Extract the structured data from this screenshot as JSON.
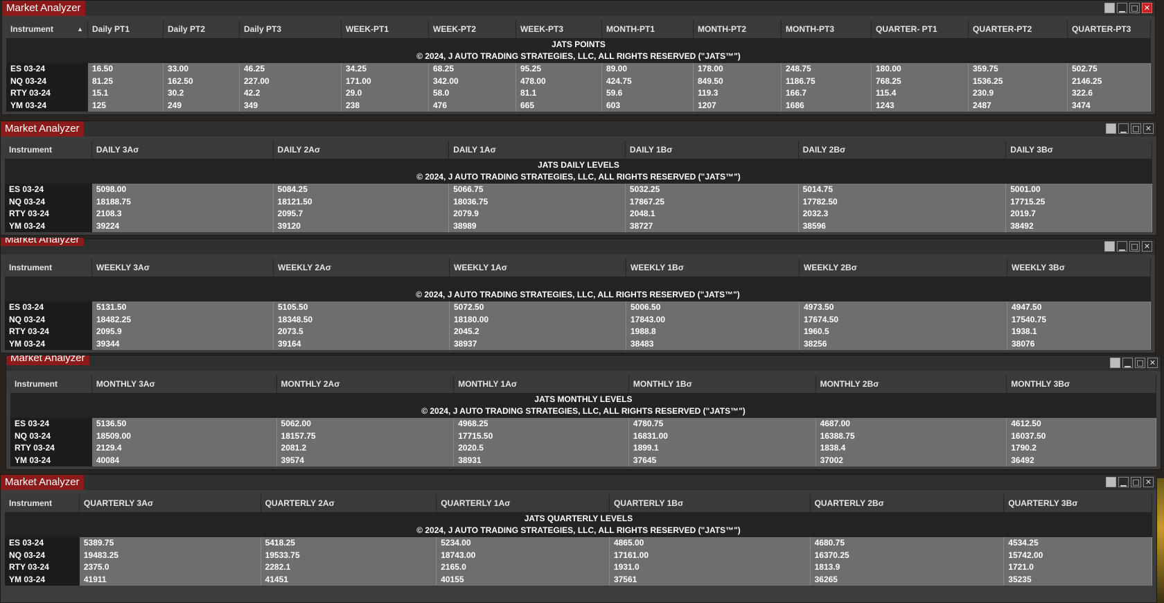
{
  "panels": [
    {
      "title": "Market Analyzer",
      "maximize_variant": "gray",
      "columns": [
        "Instrument",
        "Daily PT1",
        "Daily PT2",
        "Daily PT3",
        "WEEK-PT1",
        "WEEK-PT2",
        "WEEK-PT3",
        "MONTH-PT1",
        "MONTH-PT2",
        "MONTH-PT3",
        "QUARTER- PT1",
        "QUARTER-PT2",
        "QUARTER-PT3"
      ],
      "banner_title": "JATS POINTS",
      "banner_copyright": "© 2024, J AUTO TRADING STRATEGIES, LLC, ALL RIGHTS RESERVED (\"JATS™\")",
      "rows": [
        [
          "ES 03-24",
          "16.50",
          "33.00",
          "46.25",
          "34.25",
          "68.25",
          "95.25",
          "89.00",
          "178.00",
          "248.75",
          "180.00",
          "359.75",
          "502.75"
        ],
        [
          "NQ 03-24",
          "81.25",
          "162.50",
          "227.00",
          "171.00",
          "342.00",
          "478.00",
          "424.75",
          "849.50",
          "1186.75",
          "768.25",
          "1536.25",
          "2146.25"
        ],
        [
          "RTY 03-24",
          "15.1",
          "30.2",
          "42.2",
          "29.0",
          "58.0",
          "81.1",
          "59.6",
          "119.3",
          "166.7",
          "115.4",
          "230.9",
          "322.6"
        ],
        [
          "YM 03-24",
          "125",
          "249",
          "349",
          "238",
          "476",
          "665",
          "603",
          "1207",
          "1686",
          "1243",
          "2487",
          "3474"
        ]
      ]
    },
    {
      "title": "Market Analyzer",
      "columns": [
        "Instrument",
        "DAILY 3Aσ",
        "DAILY 2Aσ",
        "DAILY 1Aσ",
        "DAILY 1Bσ",
        "DAILY 2Bσ",
        "DAILY 3Bσ"
      ],
      "banner_title": "JATS DAILY LEVELS",
      "banner_copyright": "© 2024, J AUTO TRADING STRATEGIES, LLC, ALL RIGHTS RESERVED (\"JATS™\")",
      "rows": [
        [
          "ES 03-24",
          "5098.00",
          "5084.25",
          "5066.75",
          "5032.25",
          "5014.75",
          "5001.00"
        ],
        [
          "NQ 03-24",
          "18188.75",
          "18121.50",
          "18036.75",
          "17867.25",
          "17782.50",
          "17715.25"
        ],
        [
          "RTY 03-24",
          "2108.3",
          "2095.7",
          "2079.9",
          "2048.1",
          "2032.3",
          "2019.7"
        ],
        [
          "YM 03-24",
          "39224",
          "39120",
          "38989",
          "38727",
          "38596",
          "38492"
        ]
      ]
    },
    {
      "title": "Market Analyzer",
      "columns": [
        "Instrument",
        "WEEKLY 3Aσ",
        "WEEKLY 2Aσ",
        "WEEKLY 1Aσ",
        "WEEKLY 1Bσ",
        "WEEKLY 2Bσ",
        "WEEKLY 3Bσ"
      ],
      "banner_title": "",
      "banner_copyright": "© 2024, J AUTO TRADING STRATEGIES, LLC, ALL RIGHTS RESERVED (\"JATS™\")",
      "rows": [
        [
          "ES 03-24",
          "5131.50",
          "5105.50",
          "5072.50",
          "5006.50",
          "4973.50",
          "4947.50"
        ],
        [
          "NQ 03-24",
          "18482.25",
          "18348.50",
          "18180.00",
          "17843.00",
          "17674.50",
          "17540.75"
        ],
        [
          "RTY 03-24",
          "2095.9",
          "2073.5",
          "2045.2",
          "1988.8",
          "1960.5",
          "1938.1"
        ],
        [
          "YM 03-24",
          "39344",
          "39164",
          "38937",
          "38483",
          "38256",
          "38076"
        ]
      ]
    },
    {
      "title": "Market Analyzer",
      "columns": [
        "Instrument",
        "MONTHLY 3Aσ",
        "MONTHLY 2Aσ",
        "MONTHLY 1Aσ",
        "MONTHLY 1Bσ",
        "MONTHLY 2Bσ",
        "MONTHLY 3Bσ"
      ],
      "banner_title": "JATS MONTHLY LEVELS",
      "banner_copyright": "© 2024, J AUTO TRADING STRATEGIES, LLC, ALL RIGHTS RESERVED (\"JATS™\")",
      "rows": [
        [
          "ES 03-24",
          "5136.50",
          "5062.00",
          "4968.25",
          "4780.75",
          "4687.00",
          "4612.50"
        ],
        [
          "NQ 03-24",
          "18509.00",
          "18157.75",
          "17715.50",
          "16831.00",
          "16388.75",
          "16037.50"
        ],
        [
          "RTY 03-24",
          "2129.4",
          "2081.2",
          "2020.5",
          "1899.1",
          "1838.4",
          "1790.2"
        ],
        [
          "YM 03-24",
          "40084",
          "39574",
          "38931",
          "37645",
          "37002",
          "36492"
        ]
      ]
    },
    {
      "title": "Market Analyzer",
      "columns": [
        "Instrument",
        "QUARTERLY 3Aσ",
        "QUARTERLY 2Aσ",
        "QUARTERLY 1Aσ",
        "QUARTERLY 1Bσ",
        "QUARTERLY 2Bσ",
        "QUARTERLY 3Bσ"
      ],
      "banner_title": "JATS QUARTERLY LEVELS",
      "banner_copyright": "© 2024, J AUTO TRADING STRATEGIES, LLC, ALL RIGHTS RESERVED (\"JATS™\")",
      "rows": [
        [
          "ES 03-24",
          "5389.75",
          "5418.25",
          "5234.00",
          "4865.00",
          "4680.75",
          "4534.25"
        ],
        [
          "NQ 03-24",
          "19483.25",
          "19533.75",
          "18743.00",
          "17161.00",
          "16370.25",
          "15742.00"
        ],
        [
          "RTY 03-24",
          "2375.0",
          "2282.1",
          "2165.0",
          "1931.0",
          "1813.9",
          "1721.0"
        ],
        [
          "YM 03-24",
          "41911",
          "41451",
          "40155",
          "37561",
          "36265",
          "35235"
        ]
      ]
    }
  ],
  "sort_indicator": "▲",
  "icons": {
    "restore": "❐",
    "minimize": "▁",
    "maximize": "□",
    "close": "✕"
  }
}
